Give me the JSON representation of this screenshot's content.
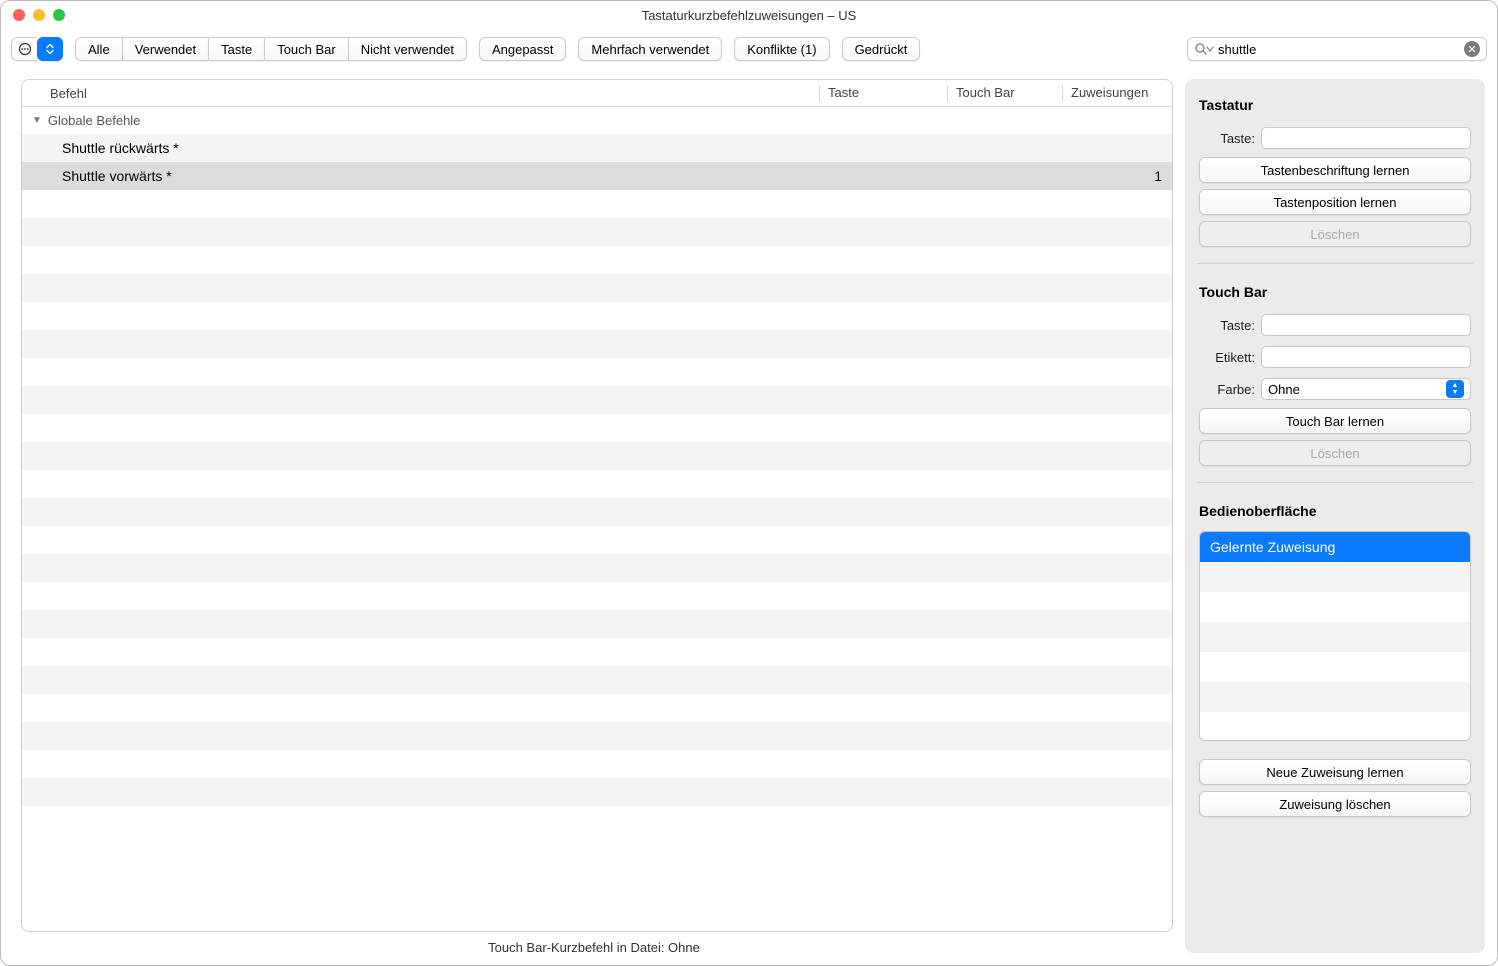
{
  "window": {
    "title": "Tastaturkurzbefehlzuweisungen – US"
  },
  "toolbar": {
    "filters": [
      "Alle",
      "Verwendet",
      "Taste",
      "Touch Bar",
      "Nicht verwendet"
    ],
    "buttons": {
      "customized": "Angepasst",
      "multi": "Mehrfach verwendet",
      "conflicts": "Konflikte (1)",
      "pressed": "Gedrückt"
    }
  },
  "search": {
    "value": "shuttle"
  },
  "table": {
    "headers": {
      "command": "Befehl",
      "key": "Taste",
      "touchbar": "Touch Bar",
      "assignments": "Zuweisungen"
    },
    "group": "Globale Befehle",
    "rows": [
      {
        "command": "Shuttle rückwärts *",
        "assignments": "",
        "selected": false
      },
      {
        "command": "Shuttle vorwärts *",
        "assignments": "1",
        "selected": true
      }
    ]
  },
  "footer": "Touch Bar-Kurzbefehl in Datei: Ohne",
  "panel": {
    "keyboard": {
      "title": "Tastatur",
      "keyLabel": "Taste:",
      "keyValue": "",
      "learnLabel": "Tastenbeschriftung lernen",
      "learnPos": "Tastenposition lernen",
      "delete": "Löschen"
    },
    "touchbar": {
      "title": "Touch Bar",
      "keyLabel": "Taste:",
      "keyValue": "",
      "etikettLabel": "Etikett:",
      "etikettValue": "",
      "colorLabel": "Farbe:",
      "colorValue": "Ohne",
      "learn": "Touch Bar lernen",
      "delete": "Löschen"
    },
    "surface": {
      "title": "Bedienoberfläche",
      "item": "Gelernte Zuweisung",
      "learn": "Neue Zuweisung lernen",
      "delete": "Zuweisung löschen"
    }
  }
}
